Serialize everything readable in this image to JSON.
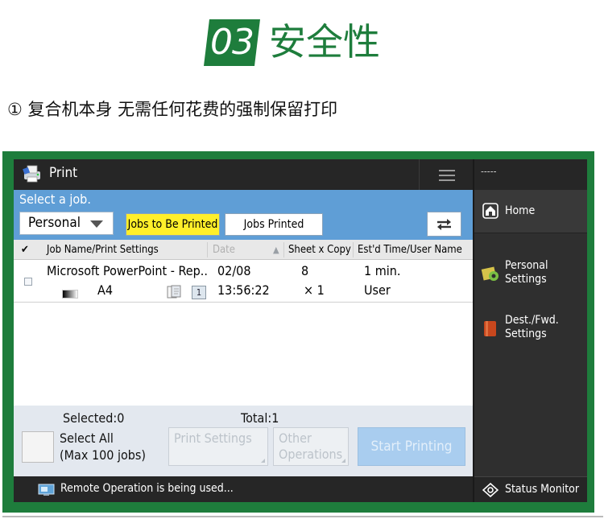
{
  "heading": {
    "number": "03",
    "title": "安全性"
  },
  "subtitle": "① 复合机本身 无需任何花费的强制保留打印",
  "app": {
    "title": "Print",
    "prompt": "Select a job.",
    "filter_value": "Personal",
    "tabs": {
      "active": "Jobs to Be Printed",
      "inactive": "Jobs Printed"
    },
    "columns": {
      "check": "✔",
      "name": "Job Name/Print Settings",
      "date": "Date",
      "sort_arrow": "▲",
      "sheet_copy": "Sheet x Copy",
      "time_user": "Est'd Time/User Name"
    },
    "job": {
      "name": "Microsoft PowerPoint - Rep..",
      "paper": "A4",
      "copies_box": "1",
      "date": "02/08",
      "time": "13:56:22",
      "sheets": "8",
      "copies": "× 1",
      "est_time": "1 min.",
      "user": "User"
    },
    "footer": {
      "selected": "Selected:0",
      "total": "Total:1",
      "select_all_line1": "Select All",
      "select_all_line2": "(Max 100 jobs)",
      "print_settings_line1": "Print Settings",
      "other_ops_line1": "Other",
      "other_ops_line2": "Operations",
      "start": "Start Printing"
    },
    "status_message": "Remote Operation is being used..."
  },
  "side": {
    "top": "-----",
    "home": "Home",
    "personal_line1": "Personal",
    "personal_line2": "Settings",
    "dest_line1": "Dest./Fwd.",
    "dest_line2": "Settings",
    "status_monitor": "Status Monitor"
  },
  "colors": {
    "brand_green": "#1e7d3c",
    "header_blue": "#5f9ed6",
    "active_tab_yellow": "#ffef2a",
    "dark_bar": "#262626"
  },
  "icons": [
    "print-icon",
    "menu-icon",
    "refresh-icon",
    "duplex-icon",
    "remote-operation-icon",
    "home-icon",
    "personal-settings-icon",
    "dest-fwd-settings-icon",
    "status-monitor-icon"
  ]
}
